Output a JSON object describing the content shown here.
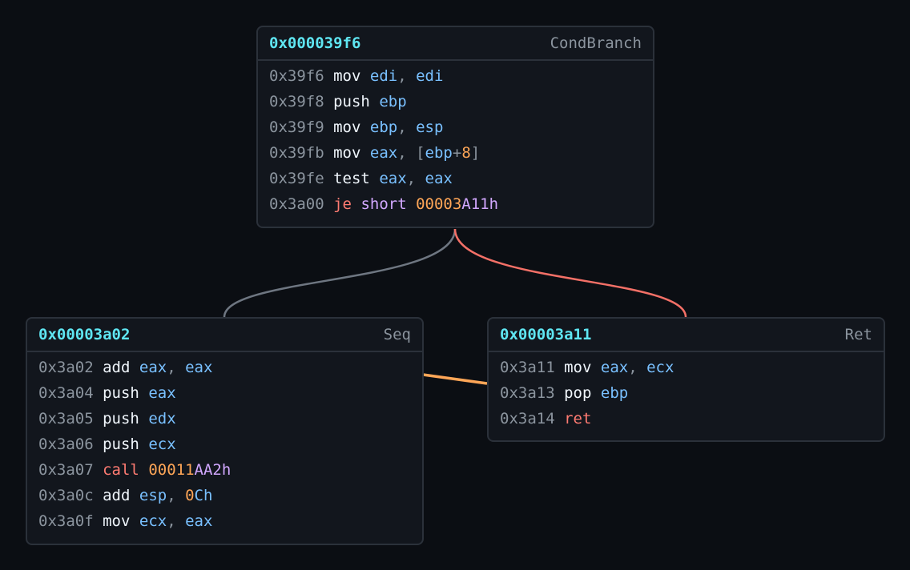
{
  "blocks": [
    {
      "id": "b39f6",
      "addr": "0x000039f6",
      "kind": "CondBranch",
      "instructions": [
        {
          "addr": "0x39f6",
          "tokens": [
            [
              "mn",
              "mov"
            ],
            [
              "sp",
              " "
            ],
            [
              "reg",
              "edi"
            ],
            [
              "punct",
              ", "
            ],
            [
              "reg",
              "edi"
            ]
          ]
        },
        {
          "addr": "0x39f8",
          "tokens": [
            [
              "mn",
              "push"
            ],
            [
              "sp",
              " "
            ],
            [
              "reg",
              "ebp"
            ]
          ]
        },
        {
          "addr": "0x39f9",
          "tokens": [
            [
              "mn",
              "mov"
            ],
            [
              "sp",
              " "
            ],
            [
              "reg",
              "ebp"
            ],
            [
              "punct",
              ", "
            ],
            [
              "reg",
              "esp"
            ]
          ]
        },
        {
          "addr": "0x39fb",
          "tokens": [
            [
              "mn",
              "mov"
            ],
            [
              "sp",
              " "
            ],
            [
              "reg",
              "eax"
            ],
            [
              "punct",
              ", ["
            ],
            [
              "reg",
              "ebp"
            ],
            [
              "punct",
              "+"
            ],
            [
              "num",
              "8"
            ],
            [
              "punct",
              "]"
            ]
          ]
        },
        {
          "addr": "0x39fe",
          "tokens": [
            [
              "mn",
              "test"
            ],
            [
              "sp",
              " "
            ],
            [
              "reg",
              "eax"
            ],
            [
              "punct",
              ", "
            ],
            [
              "reg",
              "eax"
            ]
          ]
        },
        {
          "addr": "0x3a00",
          "tokens": [
            [
              "flow",
              "je"
            ],
            [
              "sp",
              " "
            ],
            [
              "kw",
              "short"
            ],
            [
              "sp",
              " "
            ],
            [
              "num",
              "00003"
            ],
            [
              "sym",
              "A11h"
            ]
          ]
        }
      ]
    },
    {
      "id": "b3a02",
      "addr": "0x00003a02",
      "kind": "Seq",
      "instructions": [
        {
          "addr": "0x3a02",
          "tokens": [
            [
              "mn",
              "add"
            ],
            [
              "sp",
              " "
            ],
            [
              "reg",
              "eax"
            ],
            [
              "punct",
              ", "
            ],
            [
              "reg",
              "eax"
            ]
          ]
        },
        {
          "addr": "0x3a04",
          "tokens": [
            [
              "mn",
              "push"
            ],
            [
              "sp",
              " "
            ],
            [
              "reg",
              "eax"
            ]
          ]
        },
        {
          "addr": "0x3a05",
          "tokens": [
            [
              "mn",
              "push"
            ],
            [
              "sp",
              " "
            ],
            [
              "reg",
              "edx"
            ]
          ]
        },
        {
          "addr": "0x3a06",
          "tokens": [
            [
              "mn",
              "push"
            ],
            [
              "sp",
              " "
            ],
            [
              "reg",
              "ecx"
            ]
          ]
        },
        {
          "addr": "0x3a07",
          "tokens": [
            [
              "flow",
              "call"
            ],
            [
              "sp",
              " "
            ],
            [
              "num",
              "00011"
            ],
            [
              "sym",
              "AA2h"
            ]
          ]
        },
        {
          "addr": "0x3a0c",
          "tokens": [
            [
              "mn",
              "add"
            ],
            [
              "sp",
              " "
            ],
            [
              "reg",
              "esp"
            ],
            [
              "punct",
              ", "
            ],
            [
              "num",
              "0"
            ],
            [
              "reg",
              "Ch"
            ]
          ]
        },
        {
          "addr": "0x3a0f",
          "tokens": [
            [
              "mn",
              "mov"
            ],
            [
              "sp",
              " "
            ],
            [
              "reg",
              "ecx"
            ],
            [
              "punct",
              ", "
            ],
            [
              "reg",
              "eax"
            ]
          ]
        }
      ]
    },
    {
      "id": "b3a11",
      "addr": "0x00003a11",
      "kind": "Ret",
      "instructions": [
        {
          "addr": "0x3a11",
          "tokens": [
            [
              "mn",
              "mov"
            ],
            [
              "sp",
              " "
            ],
            [
              "reg",
              "eax"
            ],
            [
              "punct",
              ", "
            ],
            [
              "reg",
              "ecx"
            ]
          ]
        },
        {
          "addr": "0x3a13",
          "tokens": [
            [
              "mn",
              "pop"
            ],
            [
              "sp",
              " "
            ],
            [
              "reg",
              "ebp"
            ]
          ]
        },
        {
          "addr": "0x3a14",
          "tokens": [
            [
              "flow",
              "ret"
            ]
          ]
        }
      ]
    }
  ],
  "edges": [
    {
      "from": "0x000039f6",
      "to": "0x00003a02",
      "kind": "fallthrough",
      "color": "#6e7681"
    },
    {
      "from": "0x000039f6",
      "to": "0x00003a11",
      "kind": "branch-taken",
      "color": "#f47067"
    },
    {
      "from": "0x00003a02",
      "to": "0x00003a11",
      "kind": "sequential",
      "color": "#ffa657"
    }
  ],
  "colors": {
    "background": "#0b0e13",
    "block_bg": "#12161d",
    "block_border": "#2b313a",
    "addr_header": "#5fe6f2",
    "register": "#79c0ff",
    "mnemonic": "#f0f6fc",
    "flow_mnemonic": "#ff7b72",
    "number": "#ffa657",
    "symbol": "#d2a8ff"
  }
}
